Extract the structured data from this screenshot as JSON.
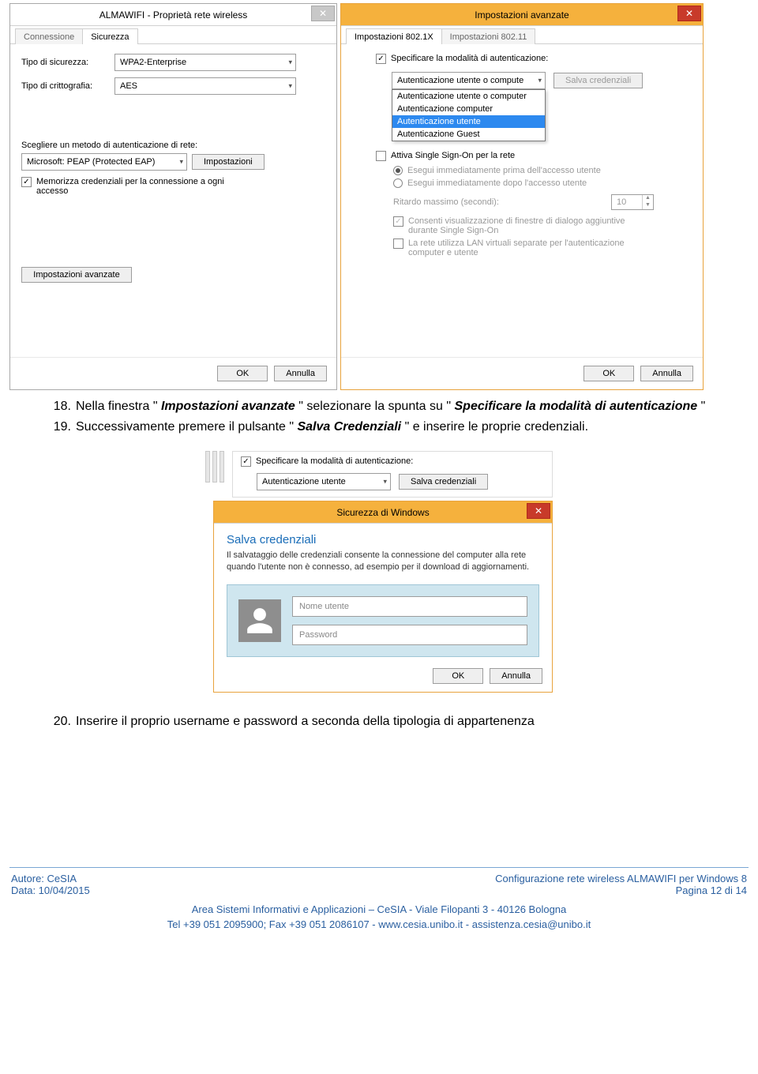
{
  "dialog_left": {
    "title": "ALMAWIFI - Proprietà rete wireless",
    "tabs": {
      "tab1": "Connessione",
      "tab2": "Sicurezza"
    },
    "security_type_label": "Tipo di sicurezza:",
    "security_type_value": "WPA2-Enterprise",
    "encryption_label": "Tipo di crittografia:",
    "encryption_value": "AES",
    "auth_method_label": "Scegliere un metodo di autenticazione di rete:",
    "auth_method_value": "Microsoft: PEAP (Protected EAP)",
    "settings_btn": "Impostazioni",
    "remember_creds": "Memorizza credenziali per la connessione a ogni accesso",
    "advanced_btn": "Impostazioni avanzate",
    "ok": "OK",
    "cancel": "Annulla"
  },
  "dialog_right": {
    "title": "Impostazioni avanzate",
    "tabs": {
      "tab1": "Impostazioni 802.1X",
      "tab2": "Impostazioni 802.11"
    },
    "specify_mode": "Specificare la modalità di autenticazione:",
    "mode_value": "Autenticazione utente o compute",
    "save_creds_btn": "Salva credenziali",
    "dropdown": {
      "opt1": "Autenticazione utente o computer",
      "opt2": "Autenticazione computer",
      "opt3": "Autenticazione utente",
      "opt4": "Autenticazione Guest"
    },
    "enable_sso": "Attiva Single Sign-On per la rete",
    "sso_before": "Esegui immediatamente prima dell'accesso utente",
    "sso_after": "Esegui immediatamente dopo l'accesso utente",
    "delay_label": "Ritardo massimo (secondi):",
    "delay_value": "10",
    "allow_dialogs": "Consenti visualizzazione di finestre di dialogo aggiuntive durante Single Sign-On",
    "vlan": "La rete utilizza LAN virtuali separate per l'autenticazione computer e utente",
    "ok": "OK",
    "cancel": "Annulla"
  },
  "instructions": {
    "n18": "18.",
    "t18_a": "Nella finestra \"",
    "t18_b": "Impostazioni avanzate",
    "t18_c": "\" selezionare la spunta su \"",
    "t18_d": "Specificare la modalità di autenticazione",
    "t18_e": "\"",
    "n19": "19.",
    "t19_a": "Successivamente premere il pulsante \"",
    "t19_b": "Salva Credenziali",
    "t19_c": "\" e inserire le proprie credenziali.",
    "n20": "20.",
    "t20": "Inserire il proprio username e password a seconda della tipologia di appartenenza"
  },
  "mid": {
    "specify_mode": "Specificare la modalità di autenticazione:",
    "mode_value": "Autenticazione utente",
    "save_btn": "Salva credenziali",
    "sec_title": "Sicurezza di Windows",
    "sub_title": "Salva credenziali",
    "blurb": "Il salvataggio delle credenziali consente la connessione del computer alla rete quando l'utente non è connesso, ad esempio per il download di aggiornamenti.",
    "user_placeholder": "Nome utente",
    "pass_placeholder": "Password",
    "ok": "OK",
    "cancel": "Annulla"
  },
  "footer": {
    "author": "Autore: CeSIA",
    "date": "Data: 10/04/2015",
    "doc_title": "Configurazione rete wireless ALMAWIFI per Windows 8",
    "page": "Pagina 12 di 14",
    "line1": "Area Sistemi Informativi e Applicazioni – CeSIA - Viale Filopanti 3 - 40126 Bologna",
    "line2": "Tel +39 051 2095900; Fax +39 051 2086107 - www.cesia.unibo.it - assistenza.cesia@unibo.it"
  }
}
